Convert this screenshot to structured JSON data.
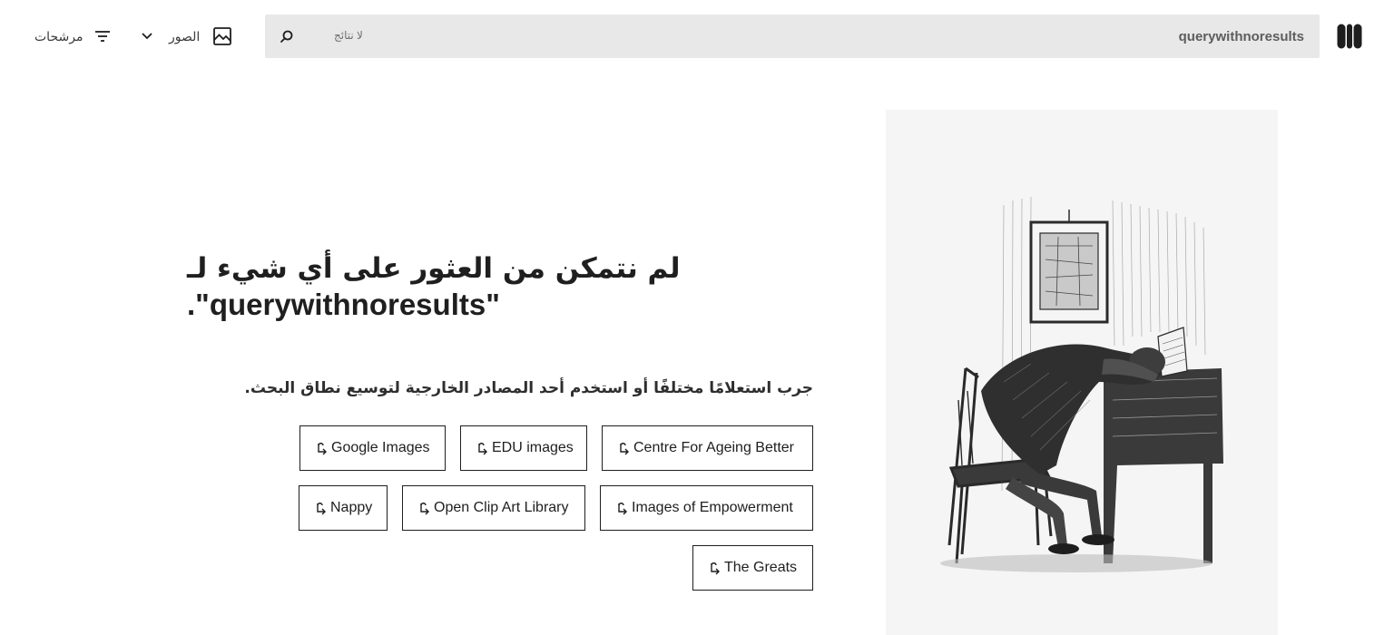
{
  "header": {
    "search": {
      "query": "querywithnoresults",
      "status": "لا نتائج"
    },
    "type_select": {
      "label": "الصور",
      "icon": "image-icon"
    },
    "filters": {
      "label": "مرشحات",
      "icon": "filter-icon"
    }
  },
  "main": {
    "heading_arabic": "لم نتمكن من العثور على أي شيء لـ",
    "heading_query": "\"querywithnoresults\".",
    "subtext": "جرب استعلامًا مختلفًا أو استخدم أحد المصادر الخارجية لتوسيع نطاق البحث.",
    "sources": [
      {
        "label": "Google Images"
      },
      {
        "label": "EDU images"
      },
      {
        "label": "Centre For Ageing Better"
      },
      {
        "label": "Nappy"
      },
      {
        "label": "Open Clip Art Library"
      },
      {
        "label": "Images of Empowerment"
      },
      {
        "label": "The Greats"
      }
    ]
  },
  "colors": {
    "search_bg": "#e8e8e8",
    "text": "#1e1e1e",
    "illustration_bg": "#f5f5f5"
  }
}
